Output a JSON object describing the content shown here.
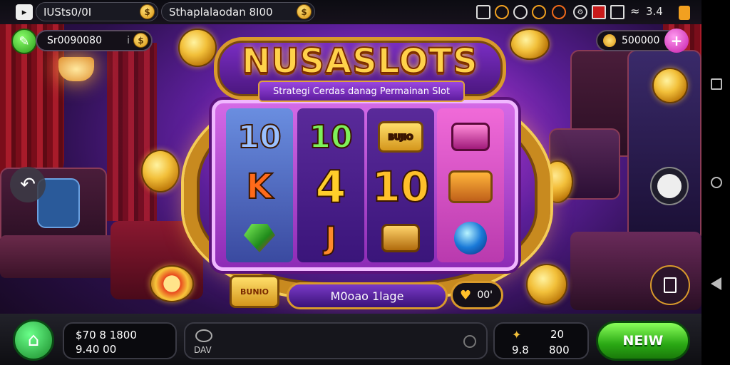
{
  "status_bar": {
    "pill1_text": "IUSts0/0I",
    "pill2_text": "Sthaplalaodan 8I00",
    "coin_glyph": "$",
    "icons": [
      "badge-icon",
      "coin-icon",
      "clock-icon",
      "coin-icon",
      "medal-icon",
      "settings-icon",
      "screen-icon",
      "network-icon",
      "wifi-icon"
    ],
    "signal_text": "3.4"
  },
  "header": {
    "balance_left": "Sr0090080",
    "balance_left_suffix": "i",
    "balance_right": "500000",
    "plus_label": "+"
  },
  "title": {
    "logo": "NUSASLOTS",
    "subtitle": "Strategi Cerdas danag Permainan Slot"
  },
  "reels": [
    {
      "symbols": [
        "10",
        "K",
        "gem"
      ],
      "bg": "#5a78c8"
    },
    {
      "symbols": [
        "10",
        "4",
        "J"
      ],
      "bg": "#4a1f86"
    },
    {
      "symbols": [
        "ticket",
        "10",
        "chest"
      ],
      "bg": "#4a1f86"
    },
    {
      "symbols": [
        "chest",
        "ticket",
        "gem"
      ],
      "bg": "#e256c9"
    }
  ],
  "ticket_label": "BUJIO",
  "ticket_label2": "BUNIO",
  "below_reels": {
    "mode_label": "M0oao 1lage",
    "bet_label": "00'"
  },
  "bottom_bar": {
    "balance_line1": "$70 8 1800",
    "balance_line2": "9.40 00",
    "left_badge": "DAV",
    "stat_a_top": "20",
    "stat_a_bottom": "9.8",
    "stat_b_bottom": "800",
    "spin_label": "NEIW"
  },
  "colors": {
    "accent_green": "#3fbf2a",
    "accent_gold": "#f2c03a",
    "accent_pink": "#e04bd0"
  }
}
